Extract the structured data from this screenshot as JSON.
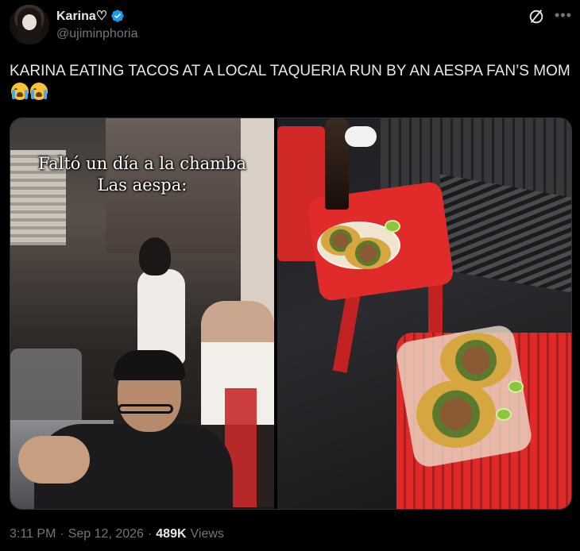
{
  "author": {
    "display_name": "Karina♡",
    "handle": "@ujiminphoria",
    "verified": true,
    "verified_color": "#1d9bf0"
  },
  "tweet": {
    "text": "KARINA EATING TACOS AT A LOCAL TAQUERIA RUN BY AN AESPA FAN’S MOM",
    "emojis": [
      "loudly-crying-face",
      "loudly-crying-face"
    ]
  },
  "media": {
    "left_caption_line1": "Faltó un día a la chamba",
    "left_caption_line2": "Las aespa:"
  },
  "meta": {
    "time": "3:11 PM",
    "separator": "·",
    "date": "Sep 12, 2026",
    "views_count": "489K",
    "views_label": "Views"
  },
  "icons": {
    "grok": "grok-icon",
    "more": "more-icon"
  }
}
